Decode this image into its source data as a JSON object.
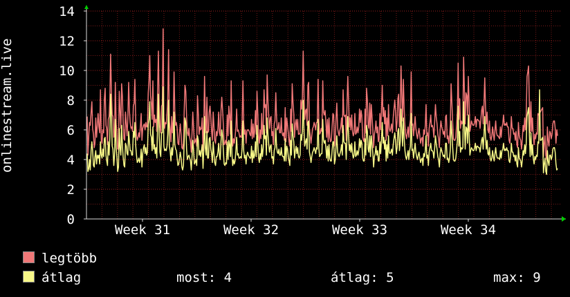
{
  "chart_data": {
    "type": "line",
    "ylabel": "onlinestream.live",
    "ylim": [
      0,
      14
    ],
    "y_ticks": [
      0,
      2,
      4,
      6,
      8,
      10,
      12,
      14
    ],
    "x_ticks": [
      "Week 31",
      "Week 32",
      "Week 33",
      "Week 34"
    ],
    "grid": true,
    "colors": {
      "background": "#000000",
      "grid": "#7a1a1a",
      "axis": "#ffffff",
      "arrow": "#00cc00"
    },
    "series": [
      {
        "name": "legtöbb",
        "color": "#f07878",
        "values": [
          6.9,
          4.3,
          5.6,
          6.5,
          6.3,
          7.2,
          7.9,
          6.1,
          5.7,
          4.8,
          5.1,
          6.8,
          5.5,
          6.3,
          7.1,
          6.2,
          5.8,
          8.7,
          5.3,
          5.1,
          6.0,
          5.8,
          8.1,
          8.8,
          6.3,
          6.1,
          5.0,
          6.7,
          6.9,
          8.1,
          11.1,
          8.6,
          7.0,
          6.9,
          5.5,
          5.7,
          9.2,
          6.4,
          5.9,
          4.7,
          4.7,
          8.6,
          7.3,
          6.1,
          9.1,
          8.3,
          6.6,
          5.4,
          5.3,
          7.2,
          6.4,
          5.6,
          6.8,
          9.2,
          7.3,
          6.5,
          6.1,
          6.2,
          5.9,
          7.6,
          7.8,
          9.4,
          6.8,
          5.6,
          5.3,
          5.5,
          5.8,
          5.5,
          6.2,
          7.1,
          5.3,
          6.1,
          6.3,
          6.4,
          6.0,
          6.5,
          6.2,
          6.2,
          8.5,
          9.3,
          11.0,
          8.3,
          7.8,
          6.7,
          9.3,
          6.2,
          7.0,
          6.5,
          6.7,
          5.9,
          8.6,
          11.3,
          7.7,
          6.2,
          5.8,
          7.6,
          7.7,
          12.8,
          6.8,
          6.1,
          6.5,
          6.4,
          7.1,
          8.1,
          11.4,
          6.6,
          6.1,
          5.2,
          6.9,
          5.8,
          6.7,
          9.9,
          7.3,
          6.3,
          6.5,
          6.1,
          5.1,
          5.0,
          5.8,
          6.4,
          5.7,
          4.8,
          4.7,
          5.1,
          7.3,
          9.0,
          8.6,
          6.9,
          5.8,
          5.6,
          6.1,
          5.5,
          5.2,
          4.5,
          5.8,
          7.2,
          6.1,
          5.1,
          5.2,
          5.4,
          4.9,
          8.3,
          7.1,
          5.7,
          6.2,
          6.0,
          6.1,
          6.8,
          4.6,
          6.3,
          9.6,
          6.8,
          5.8,
          8.2,
          5.8,
          5.9,
          7.2,
          7.6,
          6.8,
          5.9,
          5.3,
          7.2,
          6.2,
          5.3,
          5.1,
          5.9,
          5.6,
          6.1,
          7.2,
          5.8,
          5.6,
          7.3,
          8.2,
          7.4,
          6.3,
          5.0,
          5.1,
          5.3,
          5.0,
          7.0,
          5.6,
          7.6,
          6.9,
          5.7,
          9.3,
          6.1,
          4.9,
          5.4,
          5.1,
          5.5,
          6.2,
          7.4,
          5.9,
          6.0,
          5.8,
          5.5,
          5.6,
          5.5,
          6.5,
          9.3,
          6.5,
          5.7,
          6.0,
          5.1,
          5.9,
          6.0,
          6.0,
          5.9,
          5.7,
          5.6,
          6.7,
          5.4,
          6.4,
          5.5,
          5.9,
          7.3,
          5.7,
          8.6,
          7.1,
          5.5,
          5.1,
          6.0,
          5.4,
          7.1,
          5.7,
          6.4,
          8.7,
          7.5,
          7.7,
          5.8,
          9.7,
          7.9,
          6.9,
          6.1,
          6.8,
          6.9,
          5.6,
          5.9,
          5.0,
          6.4,
          6.6,
          8.5,
          6.9,
          6.0,
          6.1,
          6.5,
          5.8,
          5.8,
          6.8,
          5.8,
          5.6,
          5.8,
          5.3,
          7.5,
          5.2,
          6.8,
          6.3,
          5.8,
          5.2,
          4.9,
          7.4,
          5.9,
          9.1,
          7.8,
          7.1,
          5.5,
          6.4,
          6.7,
          6.0,
          6.7,
          5.7,
          5.7,
          5.8,
          8.0,
          7.4,
          8.1,
          11.3,
          8.5,
          6.7,
          7.3,
          7.4,
          6.3,
          9.0,
          9.2,
          6.1,
          5.6,
          5.1,
          5.6,
          6.1,
          6.2,
          6.5,
          6.3,
          6.0,
          6.5,
          6.5,
          9.4,
          6.6,
          5.7,
          5.8,
          6.1,
          5.9,
          9.3,
          7.2,
          7.0,
          7.3,
          6.5,
          5.5,
          6.7,
          5.2,
          6.8,
          5.5,
          5.2,
          5.3,
          6.2,
          7.1,
          7.0,
          4.9,
          5.4,
          6.8,
          7.8,
          6.1,
          5.8,
          5.6,
          6.0,
          6.2,
          6.8,
          5.8,
          8.7,
          7.0,
          6.9,
          7.0,
          5.3,
          7.6,
          9.6,
          7.9,
          6.2,
          6.8,
          6.0,
          7.0,
          5.9,
          5.6,
          5.8,
          7.1,
          5.7,
          5.8,
          6.2,
          5.8,
          6.2,
          7.4,
          6.5,
          7.3,
          6.9,
          5.5,
          5.3,
          5.2,
          7.4,
          5.8,
          8.8,
          8.0,
          6.3,
          6.1,
          7.8,
          5.7,
          7.7,
          6.9,
          6.0,
          4.8,
          5.7,
          6.0,
          6.6,
          5.8,
          6.2,
          5.2,
          5.3,
          7.1,
          6.0,
          7.2,
          9.0,
          6.9,
          7.5,
          6.4,
          7.3,
          5.3,
          6.8,
          5.6,
          7.7,
          6.1,
          5.9,
          6.1,
          6.4,
          5.8,
          6.8,
          7.4,
          8.0,
          7.2,
          5.9,
          6.6,
          8.1,
          8.4,
          6.2,
          7.1,
          10.3,
          8.4,
          6.6,
          9.4,
          7.5,
          6.3,
          5.7,
          5.4,
          5.8,
          6.2,
          5.5,
          6.3,
          6.7,
          9.9,
          6.3,
          6.4,
          5.6,
          6.2,
          6.9,
          6.1,
          5.7,
          5.4,
          5.8,
          6.1,
          5.6,
          5.1,
          5.4,
          5.5,
          4.9,
          6.0,
          5.7,
          6.3,
          7.7,
          5.6,
          5.8,
          4.9,
          6.1,
          6.5,
          7.0,
          6.2,
          6.3,
          6.1,
          5.5,
          6.6,
          7.7,
          6.9,
          6.4,
          5.7,
          5.4,
          4.8,
          6.0,
          6.6,
          6.2,
          6.0,
          5.7,
          5.9,
          5.5,
          6.9,
          7.0,
          5.4,
          5.6,
          5.1,
          5.6,
          6.4,
          9.1,
          7.8,
          6.5,
          5.4,
          5.3,
          5.3,
          5.5,
          6.3,
          7.3,
          10.5,
          6.7,
          8.1,
          6.1,
          6.6,
          6.4,
          6.6,
          10.9,
          8.6,
          6.4,
          8.5,
          8.3,
          7.0,
          9.6,
          8.0,
          5.9,
          6.2,
          6.6,
          6.4,
          6.3,
          6.3,
          6.5,
          6.9,
          6.2,
          6.7,
          6.7,
          6.6,
          6.6,
          6.1,
          6.7,
          7.3,
          7.6,
          6.4,
          7.7,
          9.5,
          7.5,
          6.4,
          7.2,
          6.0,
          5.8,
          6.6,
          5.5,
          5.3,
          5.6,
          6.2,
          5.7,
          5.3,
          6.0,
          6.6,
          5.8,
          5.6,
          5.6,
          5.5,
          5.4,
          6.2,
          5.5,
          6.2,
          6.4,
          7.0,
          6.3,
          6.4,
          6.3,
          6.5,
          6.2,
          6.2,
          5.3,
          5.1,
          5.7,
          6.9,
          6.1,
          6.1,
          5.7,
          5.8,
          5.3,
          5.9,
          5.0,
          4.8,
          6.5,
          5.6,
          5.4,
          5.3,
          4.7,
          5.4,
          6.3,
          5.9,
          6.8,
          6.0,
          7.0,
          9.6,
          9.9,
          10.3,
          7.7,
          5.8,
          7.9,
          5.9,
          6.8,
          5.6,
          5.0,
          5.7,
          5.4,
          5.8,
          5.7,
          7.1,
          7.0,
          7.1,
          7.2,
          7.3,
          7.4,
          7.5,
          4.2,
          5.1,
          5.6,
          4.3,
          4.0,
          6.2,
          5.3,
          4.9,
          5.9,
          5.8,
          5.4,
          5.7,
          6.4,
          6.6,
          6.6,
          6.1,
          5.1,
          6.0,
          5.6
        ]
      },
      {
        "name": "átlag",
        "color": "#f8f888",
        "values": [
          4.4,
          3.2,
          3.4,
          4.0,
          3.3,
          4.6,
          5.2,
          4.6,
          3.6,
          3.5,
          4.2,
          4.6,
          3.7,
          4.3,
          4.1,
          4.3,
          3.7,
          5.2,
          4.3,
          4.1,
          4.7,
          4.2,
          5.4,
          5.5,
          4.3,
          3.9,
          3.6,
          5.2,
          4.3,
          5.5,
          8.4,
          6.9,
          4.9,
          4.7,
          3.6,
          4.3,
          6.7,
          4.8,
          4.2,
          3.2,
          3.5,
          6.1,
          4.8,
          4.3,
          6.3,
          5.0,
          4.2,
          3.6,
          3.5,
          5.1,
          4.9,
          4.4,
          4.3,
          5.9,
          5.2,
          4.6,
          4.6,
          4.3,
          4.3,
          5.9,
          5.5,
          6.5,
          5.0,
          4.3,
          3.8,
          3.9,
          4.1,
          3.8,
          4.0,
          4.7,
          3.5,
          4.4,
          4.8,
          5.0,
          4.4,
          4.8,
          4.3,
          4.5,
          6.4,
          6.7,
          7.9,
          5.7,
          5.5,
          4.6,
          6.2,
          4.7,
          5.0,
          4.4,
          4.8,
          4.1,
          6.3,
          8.4,
          5.6,
          4.5,
          4.2,
          5.8,
          5.8,
          8.9,
          4.9,
          4.6,
          4.7,
          4.6,
          4.9,
          5.7,
          8.0,
          4.9,
          4.6,
          3.9,
          4.8,
          4.3,
          5.1,
          7.2,
          5.0,
          4.7,
          4.6,
          4.1,
          3.6,
          3.7,
          4.1,
          4.5,
          4.1,
          3.5,
          3.3,
          3.6,
          5.3,
          6.8,
          6.5,
          4.7,
          4.0,
          4.2,
          4.3,
          4.1,
          3.9,
          3.3,
          4.2,
          5.3,
          4.6,
          3.7,
          3.8,
          4.0,
          3.6,
          5.6,
          5.3,
          4.3,
          4.6,
          4.2,
          4.6,
          5.0,
          3.4,
          4.7,
          6.9,
          4.8,
          4.3,
          5.9,
          4.1,
          4.1,
          5.4,
          5.5,
          4.7,
          4.4,
          3.8,
          5.2,
          4.4,
          3.8,
          3.6,
          4.2,
          4.2,
          4.5,
          5.1,
          4.3,
          4.0,
          5.2,
          6.0,
          5.6,
          4.6,
          3.7,
          3.6,
          3.8,
          3.7,
          5.2,
          4.0,
          5.3,
          5.0,
          4.2,
          6.6,
          4.4,
          3.6,
          4.0,
          3.7,
          3.9,
          4.6,
          5.5,
          4.3,
          4.4,
          4.1,
          4.1,
          4.2,
          4.1,
          4.8,
          6.6,
          4.6,
          4.1,
          4.3,
          3.7,
          4.3,
          4.5,
          4.3,
          4.2,
          4.1,
          4.1,
          4.9,
          3.8,
          4.6,
          4.1,
          4.3,
          5.2,
          4.2,
          6.3,
          5.1,
          4.1,
          3.8,
          4.4,
          4.0,
          5.0,
          4.2,
          4.8,
          6.3,
          5.4,
          5.6,
          4.3,
          6.8,
          5.7,
          5.0,
          4.5,
          4.9,
          5.0,
          4.1,
          4.2,
          3.7,
          4.6,
          4.8,
          6.1,
          4.9,
          4.5,
          4.4,
          4.7,
          4.3,
          4.3,
          4.8,
          4.3,
          4.2,
          4.2,
          3.9,
          5.4,
          3.9,
          4.9,
          4.7,
          4.2,
          3.9,
          3.6,
          5.3,
          4.3,
          6.4,
          5.6,
          5.2,
          4.1,
          4.6,
          4.9,
          4.4,
          4.8,
          4.2,
          4.1,
          4.3,
          5.7,
          5.3,
          5.9,
          8.0,
          6.0,
          4.9,
          5.2,
          5.4,
          4.7,
          6.5,
          6.6,
          4.5,
          4.2,
          3.8,
          4.2,
          4.5,
          4.6,
          4.8,
          4.6,
          4.4,
          4.8,
          4.7,
          6.7,
          4.8,
          4.2,
          4.3,
          4.4,
          4.4,
          6.7,
          5.3,
          5.1,
          5.3,
          4.8,
          4.1,
          4.9,
          3.9,
          5.0,
          4.1,
          3.9,
          3.9,
          4.6,
          5.2,
          5.2,
          3.7,
          4.0,
          4.9,
          5.6,
          4.5,
          4.3,
          4.2,
          4.4,
          4.6,
          5.0,
          4.3,
          6.3,
          5.2,
          5.1,
          5.1,
          4.0,
          5.5,
          6.9,
          5.7,
          4.6,
          5.0,
          4.5,
          5.1,
          4.4,
          4.1,
          4.3,
          5.2,
          4.2,
          4.3,
          4.6,
          4.3,
          4.6,
          5.4,
          4.8,
          5.3,
          5.1,
          4.1,
          3.9,
          3.9,
          5.4,
          4.3,
          6.3,
          5.9,
          4.7,
          4.5,
          5.6,
          4.2,
          5.6,
          5.1,
          4.4,
          3.5,
          4.2,
          4.4,
          4.9,
          4.3,
          4.6,
          3.9,
          3.9,
          5.2,
          4.4,
          5.3,
          6.5,
          5.1,
          5.5,
          4.7,
          5.3,
          3.9,
          5.0,
          4.1,
          5.6,
          4.5,
          4.4,
          4.5,
          4.7,
          4.3,
          5.0,
          5.4,
          5.8,
          5.3,
          4.4,
          4.8,
          5.9,
          6.1,
          4.6,
          5.2,
          7.4,
          6.1,
          4.9,
          6.8,
          5.5,
          4.6,
          4.2,
          4.0,
          4.3,
          4.6,
          4.0,
          4.6,
          4.9,
          7.1,
          4.6,
          4.7,
          4.1,
          4.6,
          5.1,
          4.5,
          4.2,
          4.0,
          4.3,
          4.5,
          4.1,
          3.8,
          4.0,
          4.1,
          3.6,
          4.4,
          4.2,
          4.6,
          5.6,
          4.1,
          4.3,
          3.6,
          4.5,
          4.8,
          5.1,
          4.6,
          4.6,
          4.5,
          4.1,
          4.8,
          5.6,
          5.1,
          4.7,
          4.2,
          4.0,
          3.5,
          4.4,
          4.8,
          4.6,
          4.4,
          4.2,
          4.3,
          4.1,
          5.1,
          5.1,
          4.0,
          4.1,
          3.8,
          4.1,
          4.7,
          6.6,
          5.7,
          4.8,
          4.0,
          3.9,
          3.9,
          4.1,
          4.6,
          5.3,
          7.6,
          4.9,
          5.9,
          4.5,
          4.8,
          4.7,
          4.8,
          7.9,
          6.3,
          4.7,
          6.2,
          6.1,
          5.1,
          7.0,
          5.8,
          4.3,
          4.6,
          4.8,
          4.7,
          4.6,
          4.6,
          4.8,
          5.1,
          4.6,
          4.9,
          4.9,
          4.8,
          4.8,
          4.5,
          4.9,
          5.3,
          5.5,
          4.7,
          5.6,
          6.9,
          5.5,
          4.7,
          5.3,
          4.4,
          4.3,
          4.8,
          4.1,
          3.9,
          4.1,
          4.6,
          4.2,
          3.9,
          4.4,
          4.8,
          4.3,
          4.1,
          4.1,
          4.1,
          4.0,
          4.6,
          4.1,
          4.6,
          4.7,
          5.1,
          4.6,
          4.7,
          4.6,
          4.8,
          4.6,
          4.6,
          3.9,
          3.8,
          4.2,
          5.1,
          4.5,
          4.5,
          4.2,
          4.3,
          3.9,
          4.3,
          3.7,
          3.5,
          4.8,
          4.1,
          4.0,
          3.9,
          3.5,
          4.0,
          4.6,
          4.3,
          5.0,
          4.4,
          5.1,
          6.9,
          7.2,
          7.5,
          5.6,
          4.2,
          5.8,
          4.3,
          5.0,
          4.1,
          3.7,
          4.2,
          4.0,
          4.3,
          4.2,
          5.2,
          5.1,
          8.7,
          5.3,
          5.3,
          5.4,
          5.5,
          3.1,
          3.7,
          4.1,
          3.2,
          3.0,
          4.6,
          3.9,
          3.6,
          4.3,
          4.3,
          4.0,
          4.2,
          4.7,
          4.8,
          4.8,
          4.5,
          3.7,
          3.3,
          3.4
        ]
      }
    ]
  },
  "legend": {
    "max_label": "legtöbb",
    "avg_label": "átlag",
    "stat_current": "most: 4",
    "stat_average": "átlag: 5",
    "stat_max": "max: 9"
  }
}
